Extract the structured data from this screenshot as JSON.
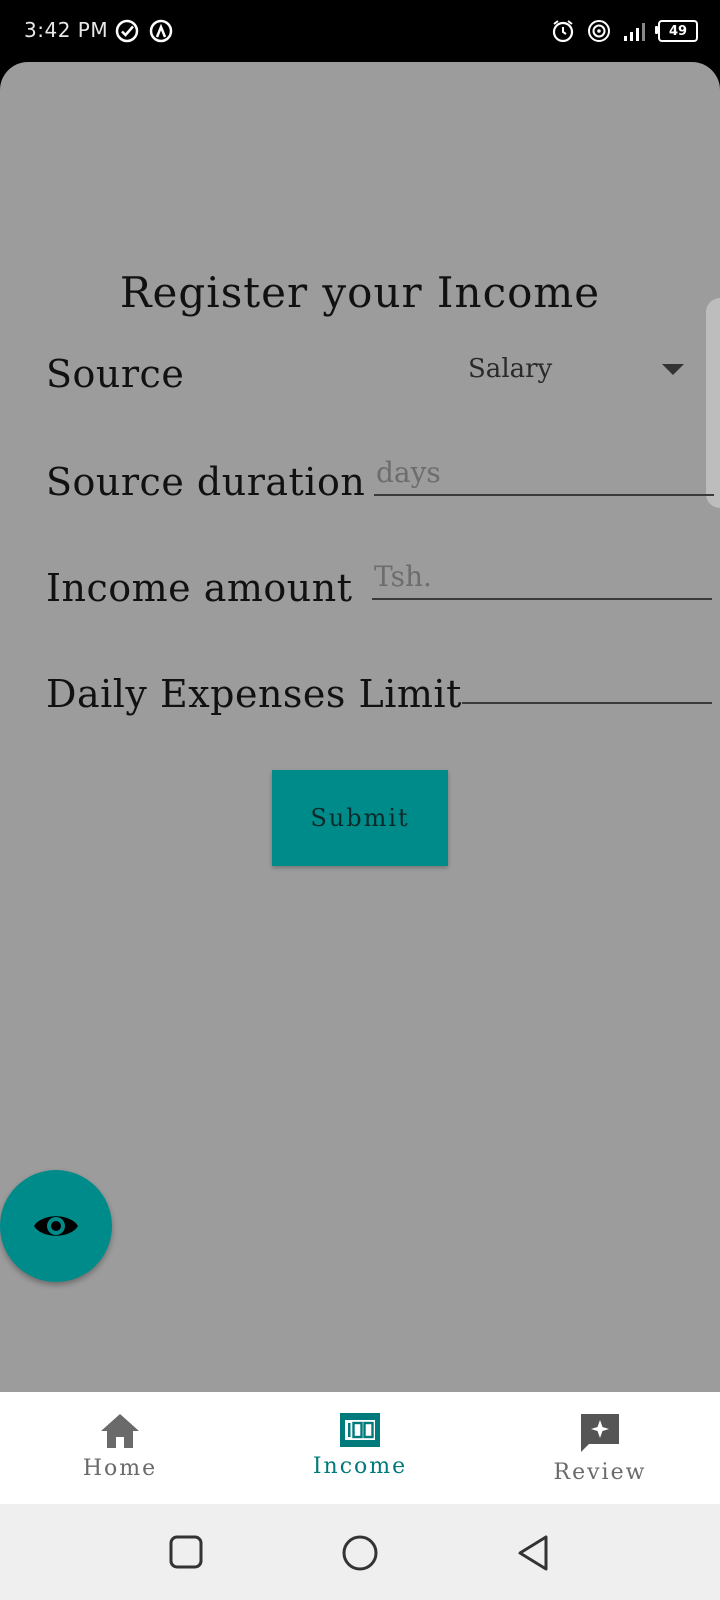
{
  "status_bar": {
    "time": "3:42 PM",
    "battery": "49",
    "left_icons": [
      "check-circle-icon",
      "hotspot-icon"
    ],
    "right_icons": [
      "alarm-icon",
      "wifi-hotspot-icon",
      "signal-icon",
      "battery-icon"
    ]
  },
  "form": {
    "title": "Register your Income",
    "source_label": "Source",
    "source_value": "Salary",
    "source_duration_label": "Source duration",
    "source_duration_placeholder": "days",
    "income_amount_label": "Income amount",
    "income_amount_placeholder": "Tsh.",
    "daily_limit_label": "Daily Expenses Limit",
    "daily_limit_placeholder": "",
    "submit_label": "Submit"
  },
  "fab": {
    "icon": "eye-icon"
  },
  "bottom_nav": {
    "items": [
      {
        "label": "Home",
        "icon": "home-icon",
        "active": false
      },
      {
        "label": "Income",
        "icon": "income-icon",
        "active": true
      },
      {
        "label": "Review",
        "icon": "review-icon",
        "active": false
      }
    ]
  },
  "colors": {
    "accent": "#008b8b",
    "sheet_background": "#9c9c9c",
    "nav_active": "#007a7a",
    "nav_inactive": "#6a6a6a"
  }
}
